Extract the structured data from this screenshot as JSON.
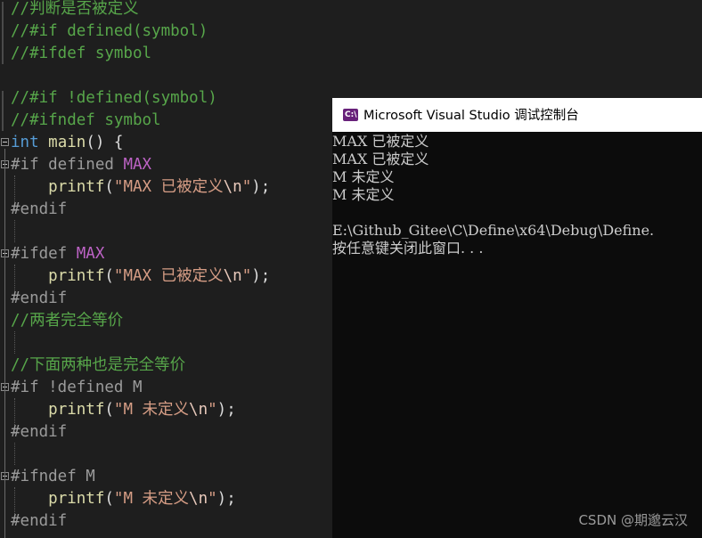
{
  "editor": {
    "lines": [
      [
        {
          "t": "//判断是否被定义",
          "c": "comment"
        }
      ],
      [
        {
          "t": "//#if defined(symbol)",
          "c": "comment"
        }
      ],
      [
        {
          "t": "//#ifdef symbol",
          "c": "comment"
        }
      ],
      [],
      [
        {
          "t": "//#if !defined(symbol)",
          "c": "comment"
        }
      ],
      [
        {
          "t": "//#ifndef symbol",
          "c": "comment"
        }
      ],
      [
        {
          "t": "int",
          "c": "kw"
        },
        {
          "t": " ",
          "c": "plain"
        },
        {
          "t": "main",
          "c": "fn"
        },
        {
          "t": "() {",
          "c": "plain"
        }
      ],
      [
        {
          "t": "#if defined ",
          "c": "pp"
        },
        {
          "t": "MAX",
          "c": "macro"
        }
      ],
      [
        {
          "t": "    ",
          "c": "plain"
        },
        {
          "t": "printf",
          "c": "fn"
        },
        {
          "t": "(",
          "c": "plain"
        },
        {
          "t": "\"MAX 已被定义",
          "c": "str"
        },
        {
          "t": "\\n",
          "c": "esc"
        },
        {
          "t": "\"",
          "c": "str"
        },
        {
          "t": ");",
          "c": "plain"
        }
      ],
      [
        {
          "t": "#endif",
          "c": "pp"
        }
      ],
      [],
      [
        {
          "t": "#ifdef ",
          "c": "pp"
        },
        {
          "t": "MAX",
          "c": "macro"
        }
      ],
      [
        {
          "t": "    ",
          "c": "plain"
        },
        {
          "t": "printf",
          "c": "fn"
        },
        {
          "t": "(",
          "c": "plain"
        },
        {
          "t": "\"MAX 已被定义",
          "c": "str"
        },
        {
          "t": "\\n",
          "c": "esc"
        },
        {
          "t": "\"",
          "c": "str"
        },
        {
          "t": ");",
          "c": "plain"
        }
      ],
      [
        {
          "t": "#endif",
          "c": "pp"
        }
      ],
      [
        {
          "t": "//两者完全等价",
          "c": "comment"
        }
      ],
      [],
      [
        {
          "t": "//下面两种也是完全等价",
          "c": "comment"
        }
      ],
      [
        {
          "t": "#if !defined M",
          "c": "pp"
        }
      ],
      [
        {
          "t": "    ",
          "c": "plain"
        },
        {
          "t": "printf",
          "c": "fn"
        },
        {
          "t": "(",
          "c": "plain"
        },
        {
          "t": "\"M 未定义",
          "c": "str"
        },
        {
          "t": "\\n",
          "c": "esc"
        },
        {
          "t": "\"",
          "c": "str"
        },
        {
          "t": ");",
          "c": "plain"
        }
      ],
      [
        {
          "t": "#endif",
          "c": "pp"
        }
      ],
      [],
      [
        {
          "t": "#ifndef M",
          "c": "pp"
        }
      ],
      [
        {
          "t": "    ",
          "c": "plain"
        },
        {
          "t": "printf",
          "c": "fn"
        },
        {
          "t": "(",
          "c": "plain"
        },
        {
          "t": "\"M 未定义",
          "c": "str"
        },
        {
          "t": "\\n",
          "c": "esc"
        },
        {
          "t": "\"",
          "c": "str"
        },
        {
          "t": ");",
          "c": "plain"
        }
      ],
      [
        {
          "t": "#endif",
          "c": "pp"
        }
      ]
    ]
  },
  "console": {
    "title": "Microsoft Visual Studio 调试控制台",
    "icon": "visual-studio-console-icon",
    "icon_label": "C:\\",
    "output": [
      "MAX 已被定义",
      "MAX 已被定义",
      "M 未定义",
      "M 未定义",
      "",
      "E:\\Github_Gitee\\C\\Define\\x64\\Debug\\Define.",
      "按任意键关闭此窗口. . ."
    ]
  },
  "watermark": "CSDN @期邈云汉",
  "colors": {
    "comment": "#57a64a",
    "preprocessor": "#9b9b9b",
    "keyword": "#569cd6",
    "function": "#dcdcaa",
    "macro": "#bd63c5",
    "string": "#d69d85",
    "background": "#1e1e1e",
    "console_bg": "#0c0c0c"
  }
}
